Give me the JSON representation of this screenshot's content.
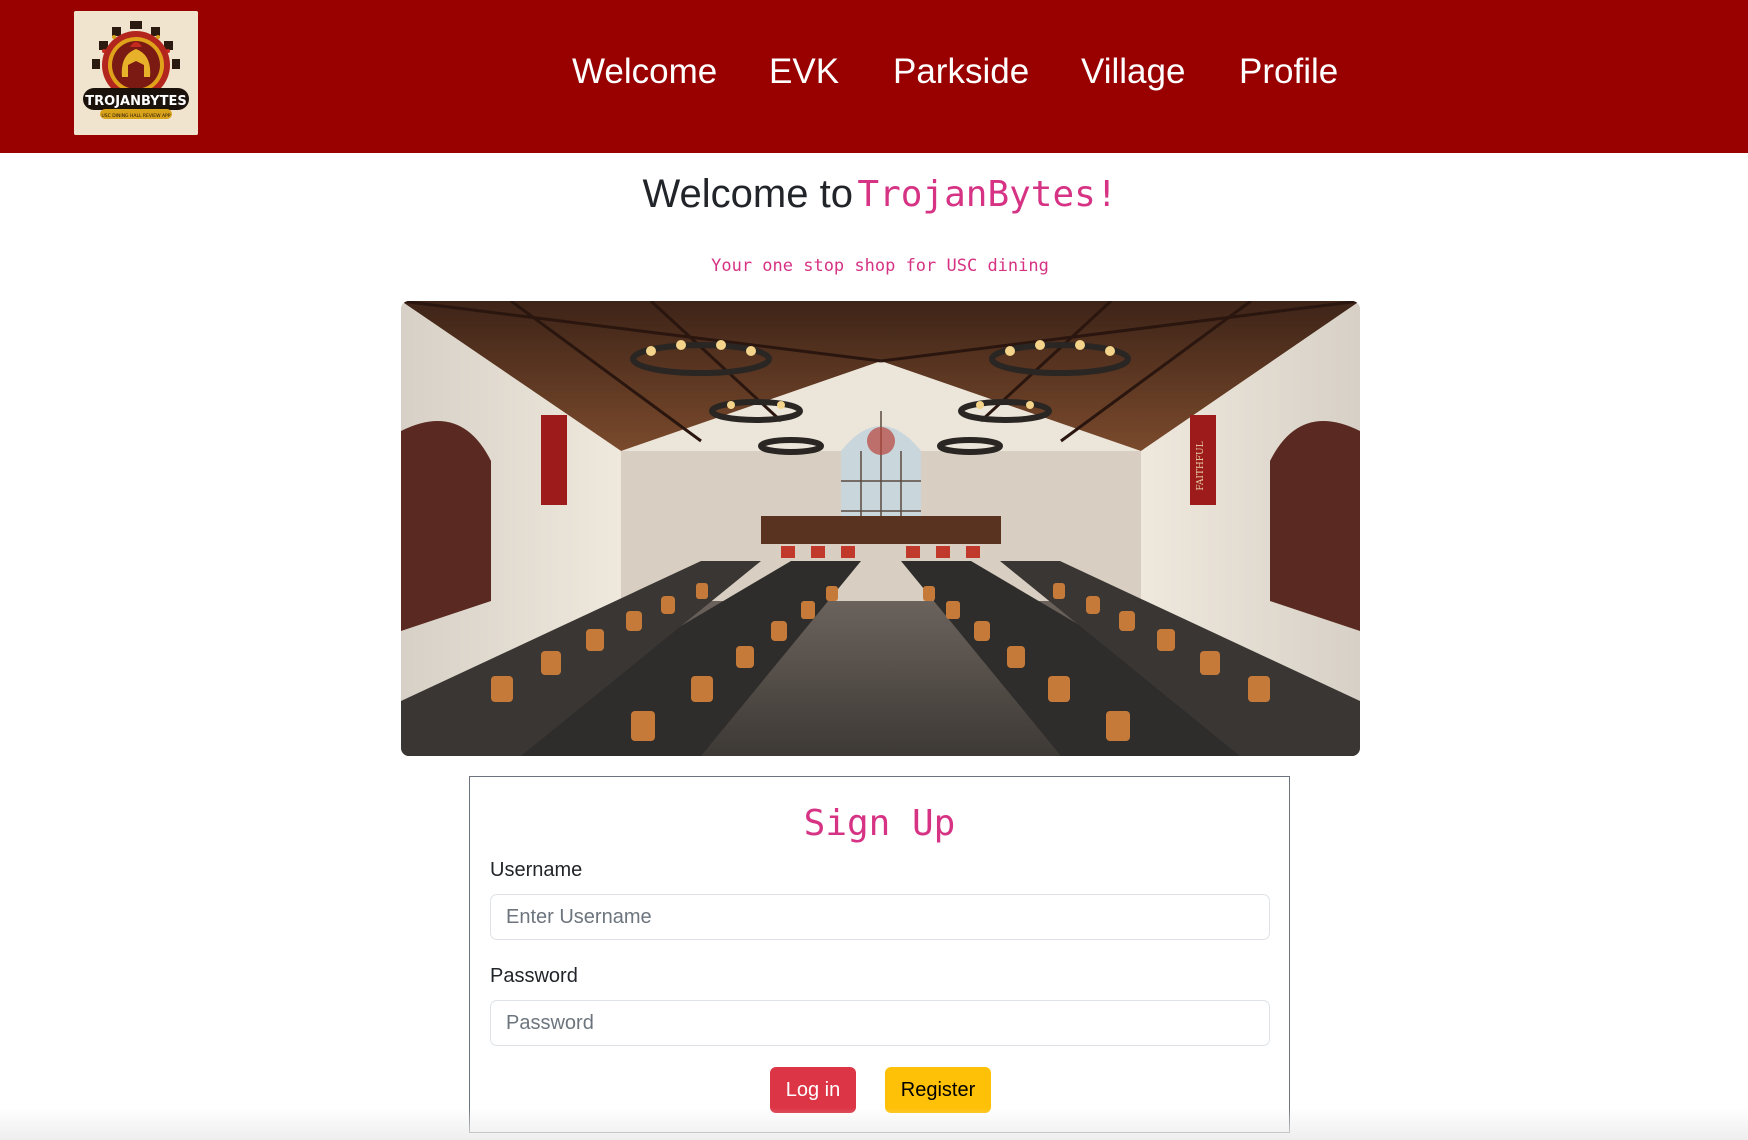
{
  "navbar": {
    "logo": {
      "alt": "TrojanBytes logo",
      "text": "TROJANBYTES",
      "subtext": "USC DINING HALL REVIEW APP"
    },
    "links": [
      {
        "label": "Welcome"
      },
      {
        "label": "EVK"
      },
      {
        "label": "Parkside"
      },
      {
        "label": "Village"
      },
      {
        "label": "Profile"
      }
    ]
  },
  "main": {
    "heading_lead": "Welcome to",
    "heading_brand": "TrojanBytes!",
    "tagline": "Your one stop shop for USC dining",
    "hero_alt": "USC dining hall interior with long tables and chandeliers",
    "hero_banner_text": "FAITHFUL"
  },
  "signup": {
    "title": "Sign Up",
    "username_label": "Username",
    "username_placeholder": "Enter Username",
    "username_value": "",
    "password_label": "Password",
    "password_placeholder": "Password",
    "password_value": "",
    "login_label": "Log in",
    "register_label": "Register"
  },
  "colors": {
    "navbar_bg": "#990000",
    "accent_pink": "#d63384",
    "login_button": "#dc3545",
    "register_button": "#ffc107"
  }
}
